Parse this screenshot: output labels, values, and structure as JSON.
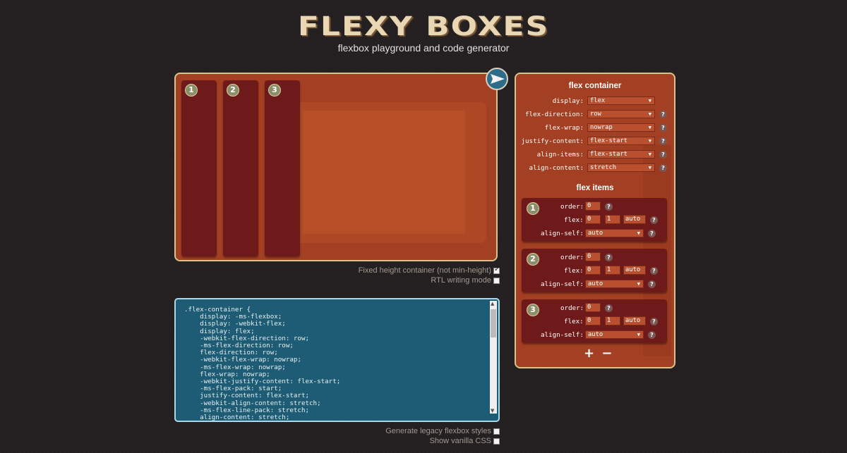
{
  "header": {
    "logo": "FLEXY BOXES",
    "tagline": "flexbox playground and code generator"
  },
  "preview": {
    "items": [
      "1",
      "2",
      "3"
    ]
  },
  "options": {
    "fixed_height": {
      "label": "Fixed height container (not min-height)",
      "checked": true
    },
    "rtl": {
      "label": "RTL writing mode",
      "checked": false
    },
    "legacy": {
      "label": "Generate legacy flexbox styles",
      "checked": false
    },
    "vanilla": {
      "label": "Show vanilla CSS",
      "checked": false
    }
  },
  "code": {
    "text": ".flex-container {\n    display: -ms-flexbox;\n    display: -webkit-flex;\n    display: flex;\n    -webkit-flex-direction: row;\n    -ms-flex-direction: row;\n    flex-direction: row;\n    -webkit-flex-wrap: nowrap;\n    -ms-flex-wrap: nowrap;\n    flex-wrap: nowrap;\n    -webkit-justify-content: flex-start;\n    -ms-flex-pack: start;\n    justify-content: flex-start;\n    -webkit-align-content: stretch;\n    -ms-flex-line-pack: stretch;\n    align-content: stretch;"
  },
  "panel": {
    "container_title": "flex container",
    "container_props": [
      {
        "label": "display:",
        "value": "flex",
        "help": false
      },
      {
        "label": "flex-direction:",
        "value": "row",
        "help": true
      },
      {
        "label": "flex-wrap:",
        "value": "nowrap",
        "help": true
      },
      {
        "label": "justify-content:",
        "value": "flex-start",
        "help": true
      },
      {
        "label": "align-items:",
        "value": "flex-start",
        "help": true
      },
      {
        "label": "align-content:",
        "value": "stretch",
        "help": true
      }
    ],
    "items_title": "flex items",
    "items": [
      {
        "num": "1",
        "order_label": "order:",
        "order": "0",
        "flex_label": "flex:",
        "grow": "0",
        "shrink": "1",
        "basis": "auto",
        "align_label": "align-self:",
        "align": "auto"
      },
      {
        "num": "2",
        "order_label": "order:",
        "order": "0",
        "flex_label": "flex:",
        "grow": "0",
        "shrink": "1",
        "basis": "auto",
        "align_label": "align-self:",
        "align": "auto"
      },
      {
        "num": "3",
        "order_label": "order:",
        "order": "0",
        "flex_label": "flex:",
        "grow": "0",
        "shrink": "1",
        "basis": "auto",
        "align_label": "align-self:",
        "align": "auto"
      }
    ],
    "help_glyph": "?",
    "select_arrow": "▼",
    "add_label": "+",
    "remove_label": "−"
  }
}
